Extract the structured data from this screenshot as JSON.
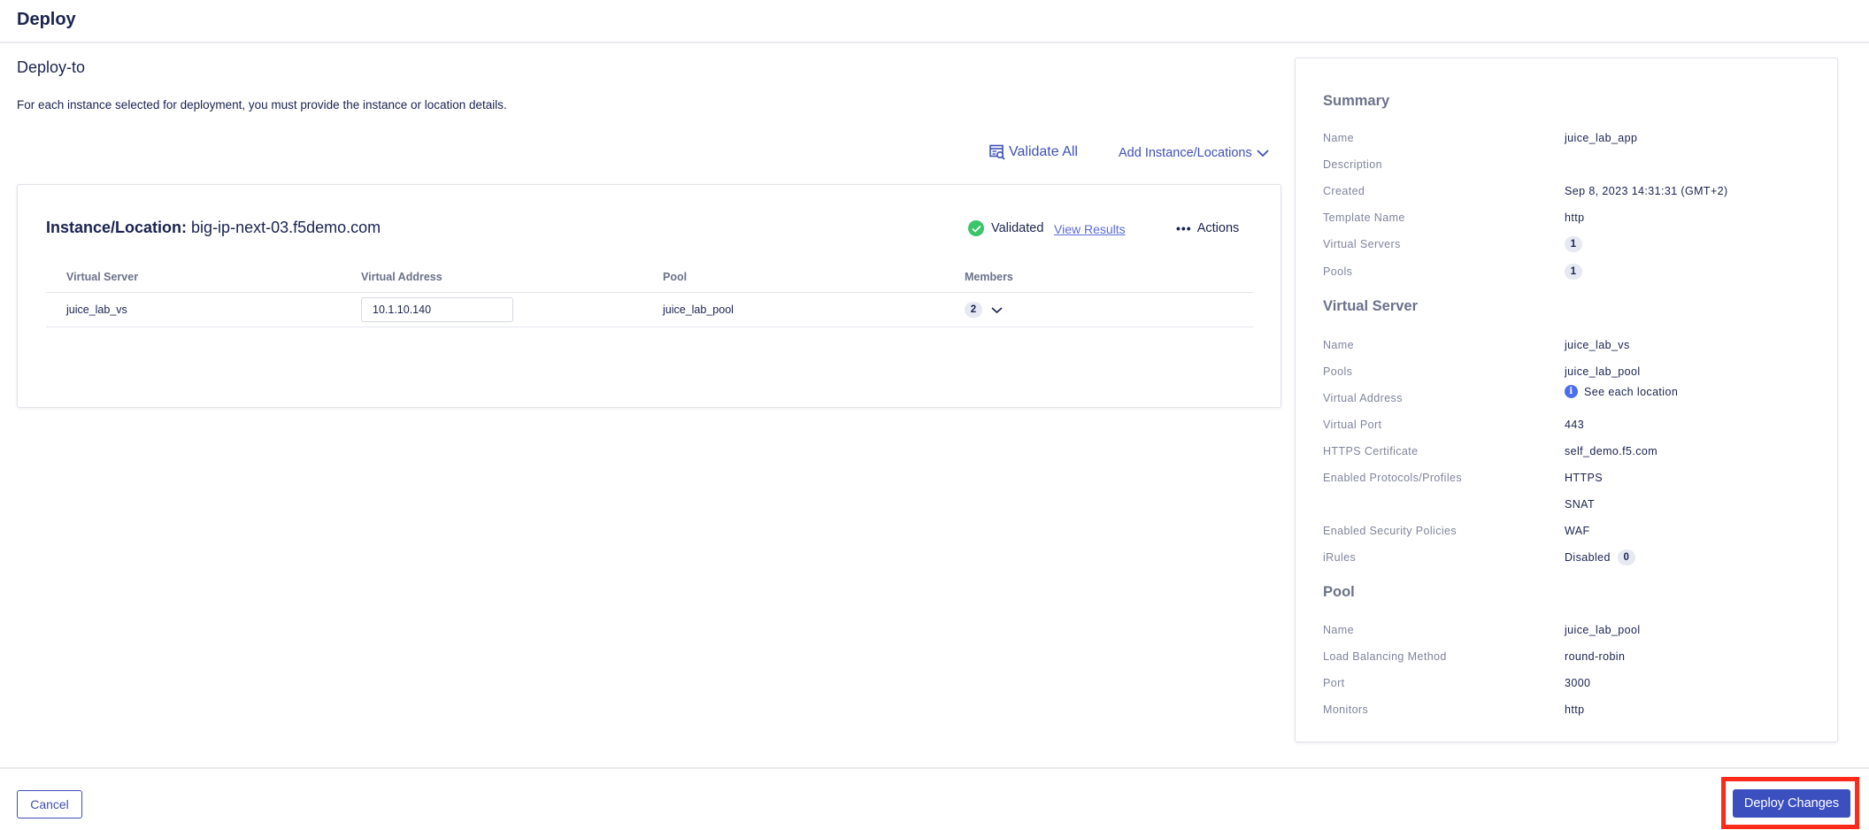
{
  "header": {
    "title": "Deploy"
  },
  "section": {
    "title": "Deploy-to",
    "description": "For each instance selected for deployment, you must provide the instance or location details."
  },
  "toolbar": {
    "validate_all_label": "Validate All",
    "add_instance_label": "Add Instance/Locations"
  },
  "instance": {
    "title_label": "Instance/Location:",
    "title_value": "big-ip-next-03.f5demo.com",
    "status": "Validated",
    "status_color": "#3cc469",
    "view_results_label": "View Results",
    "actions_label": "Actions",
    "table": {
      "headers": [
        "Virtual Server",
        "Virtual Address",
        "Pool",
        "Members"
      ],
      "rows": [
        {
          "virtual_server": "juice_lab_vs",
          "virtual_address": "10.1.10.140",
          "pool": "juice_lab_pool",
          "members": "2"
        }
      ]
    }
  },
  "summary": {
    "heading": "Summary",
    "rows": [
      {
        "label": "Name",
        "value": "juice_lab_app"
      },
      {
        "label": "Description",
        "value": ""
      },
      {
        "label": "Created",
        "value": "Sep 8, 2023 14:31:31 (GMT+2)"
      },
      {
        "label": "Template Name",
        "value": "http"
      },
      {
        "label": "Virtual Servers",
        "badge": "1"
      },
      {
        "label": "Pools",
        "badge": "1"
      }
    ],
    "virtual_server": {
      "heading": "Virtual Server",
      "rows": [
        {
          "label": "Name",
          "value": "juice_lab_vs"
        },
        {
          "label": "Pools",
          "value": "juice_lab_pool"
        },
        {
          "label": "Virtual Address",
          "value": "See each location",
          "icon": "info-icon"
        },
        {
          "label": "Virtual Port",
          "value": "443"
        },
        {
          "label": "HTTPS Certificate",
          "value": "self_demo.f5.com"
        },
        {
          "label": "Enabled Protocols/Profiles",
          "value": "HTTPS"
        },
        {
          "label": "",
          "value": "SNAT"
        },
        {
          "label": "Enabled Security Policies",
          "value": "WAF"
        },
        {
          "label": "iRules",
          "value": "Disabled",
          "badge": "0"
        }
      ]
    },
    "pool": {
      "heading": "Pool",
      "rows": [
        {
          "label": "Name",
          "value": "juice_lab_pool"
        },
        {
          "label": "Load Balancing Method",
          "value": "round-robin"
        },
        {
          "label": "Port",
          "value": "3000"
        },
        {
          "label": "Monitors",
          "value": "http"
        }
      ]
    }
  },
  "footer": {
    "cancel_label": "Cancel",
    "deploy_label": "Deploy Changes",
    "highlight_color": "#ff2a1a"
  },
  "colors": {
    "primary": "#3f51b5",
    "text": "#1b2350",
    "muted": "#6b7289",
    "success": "#3cc469",
    "info": "#4a6ef0"
  }
}
